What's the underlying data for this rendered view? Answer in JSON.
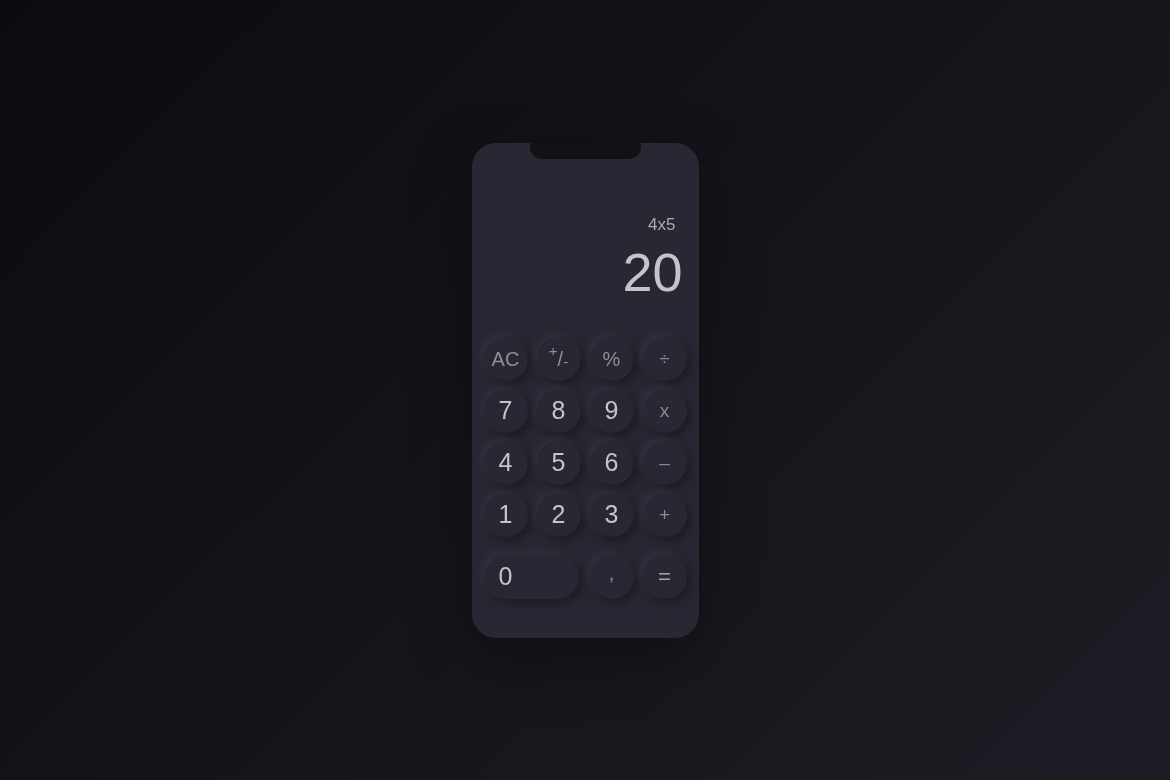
{
  "display": {
    "expression": "4x5",
    "result": "20"
  },
  "keypad": {
    "keys": [
      {
        "label": "AC",
        "kind": "function",
        "wide": false
      },
      {
        "label": "$^{+}$/$_{-}$",
        "kind": "function",
        "wide": false
      },
      {
        "label": "%",
        "kind": "function",
        "wide": false
      },
      {
        "label": "÷",
        "kind": "operator",
        "wide": false
      },
      {
        "label": "7",
        "kind": "digit",
        "wide": false
      },
      {
        "label": "8",
        "kind": "digit",
        "wide": false
      },
      {
        "label": "9",
        "kind": "digit",
        "wide": false
      },
      {
        "label": "x",
        "kind": "operator",
        "wide": false
      },
      {
        "label": "4",
        "kind": "digit",
        "wide": false
      },
      {
        "label": "5",
        "kind": "digit",
        "wide": false
      },
      {
        "label": "6",
        "kind": "digit",
        "wide": false
      },
      {
        "label": "–",
        "kind": "operator",
        "wide": false
      },
      {
        "label": "1",
        "kind": "digit",
        "wide": false
      },
      {
        "label": "2",
        "kind": "digit",
        "wide": false
      },
      {
        "label": "3",
        "kind": "digit",
        "wide": false
      },
      {
        "label": "+",
        "kind": "operator",
        "wide": false
      },
      {
        "label": "0",
        "kind": "digit",
        "wide": true
      },
      {
        "label": ",",
        "kind": "decimal",
        "wide": false
      },
      {
        "label": "=",
        "kind": "equals",
        "wide": false
      }
    ]
  }
}
